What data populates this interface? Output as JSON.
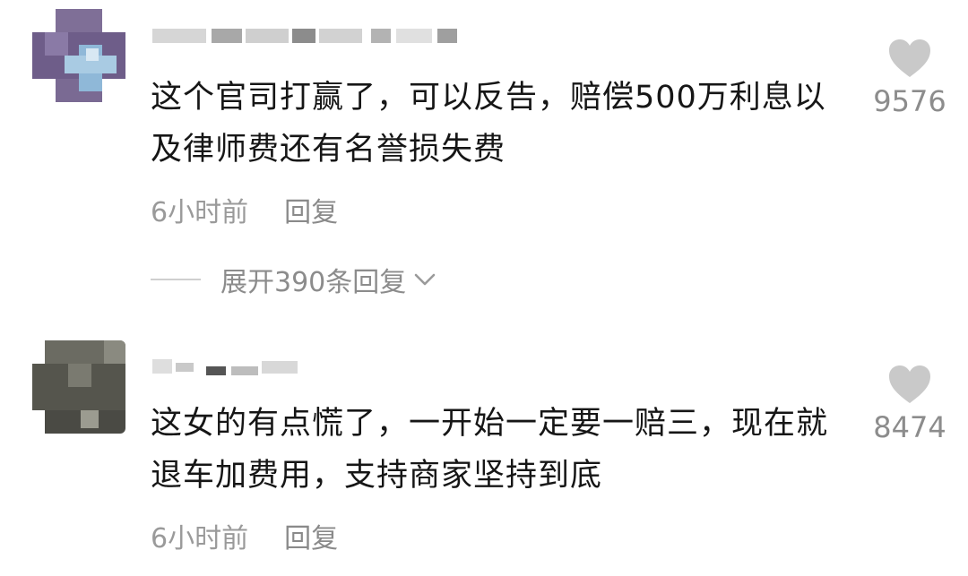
{
  "comments": [
    {
      "text": "这个官司打赢了，可以反告，赔偿500万利息以及律师费还有名誉损失费",
      "time": "6小时前",
      "reply_label": "回复",
      "likes": "9576",
      "expand_label": "展开390条回复"
    },
    {
      "text": "这女的有点慌了，一开始一定要一赔三，现在就退车加费用，支持商家坚持到底",
      "time": "6小时前",
      "reply_label": "回复",
      "likes": "8474"
    }
  ],
  "colors": {
    "text": "#161616",
    "meta": "#9a9a9a",
    "heart": "#c9c9c9"
  },
  "icons": [
    "heart-icon",
    "chevron-down-icon"
  ]
}
